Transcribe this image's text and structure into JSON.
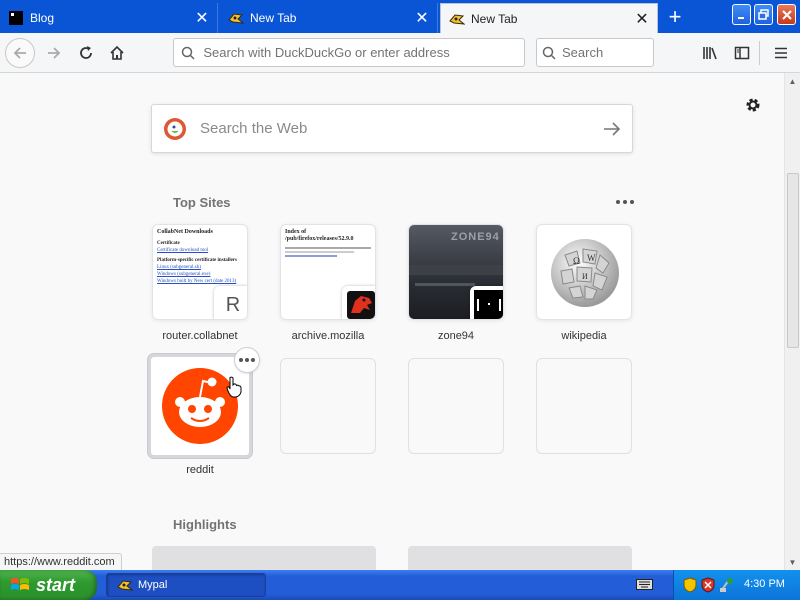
{
  "tabs": [
    {
      "title": "Blog",
      "state": "inactive",
      "icon": "blog-favicon"
    },
    {
      "title": "New Tab",
      "state": "inactive",
      "icon": "mypal-favicon"
    },
    {
      "title": "New Tab",
      "state": "active",
      "icon": "mypal-favicon"
    }
  ],
  "toolbar": {
    "url_placeholder": "Search with DuckDuckGo or enter address",
    "search_placeholder": "Search"
  },
  "newtab": {
    "web_search_placeholder": "Search the Web",
    "top_sites_title": "Top Sites",
    "highlights_title": "Highlights",
    "top_sites": [
      {
        "label": "router.collabnet",
        "badge": "R"
      },
      {
        "label": "archive.mozilla"
      },
      {
        "label": "zone94"
      },
      {
        "label": "wikipedia"
      },
      {
        "label": "reddit"
      }
    ],
    "collabnet_preview": {
      "title": "CollabNet Downloads",
      "h1": "Certificate",
      "l1": "Certificate download tool",
      "h2": "Platform-specific certificate installers",
      "l2": "Linux (subgeneral.sh)",
      "l3": "Windows (subgeneral.exe)",
      "l4": "Windows built by New cert (date 2013)"
    },
    "mozilla_preview": {
      "title": "Index of /pub/firefox/releases/52.9.0"
    },
    "zone94_preview": {
      "title": "ZONE94"
    }
  },
  "statusbar": {
    "text": "https://www.reddit.com"
  },
  "taskbar": {
    "start_label": "start",
    "task_label": "Mypal",
    "clock": "4:30 PM"
  },
  "colors": {
    "tabbar": "#0a55d6",
    "reddit": "#ff4500",
    "duckduckgo": "#de5833",
    "taskbar": "#245dd8"
  }
}
